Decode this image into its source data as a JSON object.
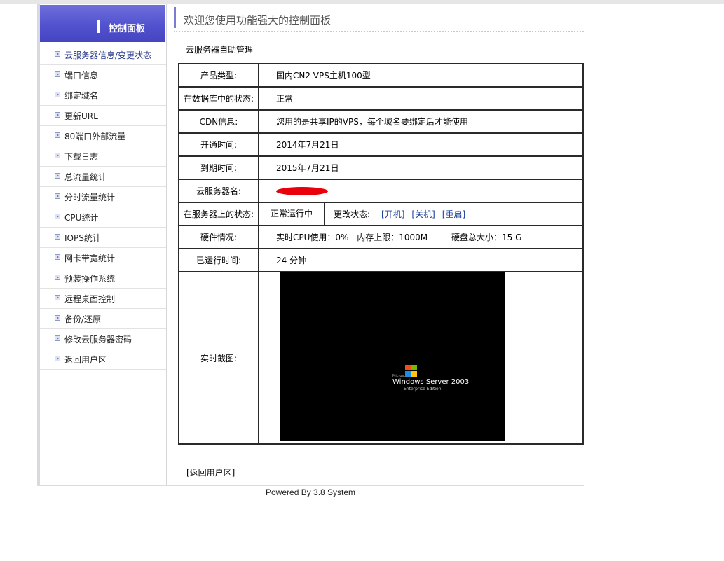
{
  "sidebar": {
    "title": "控制面板",
    "items": [
      {
        "label": "云服务器信息/变更状态"
      },
      {
        "label": "端口信息"
      },
      {
        "label": "绑定域名"
      },
      {
        "label": "更新URL"
      },
      {
        "label": "80端口外部流量"
      },
      {
        "label": "下载日志"
      },
      {
        "label": "总流量统计"
      },
      {
        "label": "分时流量统计"
      },
      {
        "label": "CPU统计"
      },
      {
        "label": "IOPS统计"
      },
      {
        "label": "网卡带宽统计"
      },
      {
        "label": "预装操作系统"
      },
      {
        "label": "远程桌面控制"
      },
      {
        "label": "备份/还原"
      },
      {
        "label": "修改云服务器密码"
      },
      {
        "label": "返回用户区"
      }
    ]
  },
  "header": {
    "welcome": "欢迎您使用功能强大的控制面板"
  },
  "main": {
    "section_title": "云服务器自助管理",
    "product_type": {
      "label": "产品类型:",
      "value": "国内CN2 VPS主机100型"
    },
    "db_status": {
      "label": "在数据库中的状态:",
      "value": "正常"
    },
    "cdn_info": {
      "label": "CDN信息:",
      "value": "您用的是共享IP的VPS，每个域名要绑定后才能使用"
    },
    "open_time": {
      "label": "开通时间:",
      "value": "2014年7月21日"
    },
    "expire_time": {
      "label": "到期时间:",
      "value": "2015年7月21日"
    },
    "server_name": {
      "label": "云服务器名:"
    },
    "server_status": {
      "label": "在服务器上的状态:",
      "value": "正常运行中",
      "change_label": "更改状态:",
      "actions": [
        "[开机]",
        "[关机]",
        "[重启]"
      ]
    },
    "hardware": {
      "label": "硬件情况:",
      "cpu": "实时CPU使用：0%",
      "memory": "内存上限：1000M",
      "disk": "硬盘总大小：15 G"
    },
    "uptime": {
      "label": "已运行时间:",
      "value": "24 分钟"
    },
    "screenshot": {
      "label": "实时截图:",
      "microsoft": "Microsoft",
      "os_title": "Windows Server 2003",
      "os_edition": "Enterprise Edition"
    },
    "back_link": "[返回用户区]"
  },
  "footer": {
    "text": "Powered By 3.8 System"
  },
  "colors": {
    "sidebar_header": "#5252cf",
    "link": "#1a3f9b",
    "redaction": "#e8000a"
  }
}
